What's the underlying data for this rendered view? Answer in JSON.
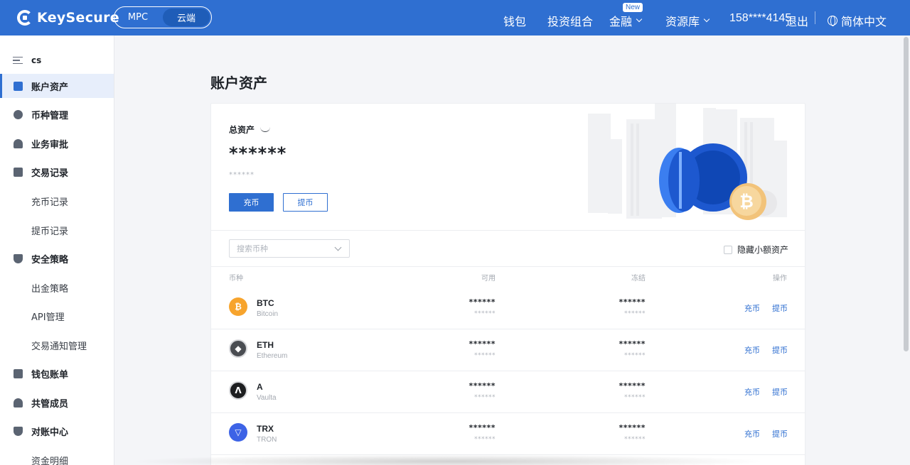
{
  "header": {
    "logo_text": "KeySecure",
    "mode_tabs": [
      "MPC",
      "云端"
    ],
    "nav": {
      "wallet": "钱包",
      "portfolio": "投资组合",
      "finance": "金融",
      "finance_badge": "New",
      "resources": "资源库",
      "phone": "158****4145",
      "logout": "退出",
      "language": "简体中文"
    }
  },
  "sidebar": {
    "org_name": "cs",
    "items": [
      {
        "label": "账户资产",
        "icon": "wallet-icon",
        "active": true
      },
      {
        "label": "币种管理",
        "icon": "coin-icon"
      },
      {
        "label": "业务审批",
        "icon": "approval-icon"
      },
      {
        "label": "交易记录",
        "icon": "document-icon"
      },
      {
        "label": "充币记录",
        "sub": true
      },
      {
        "label": "提币记录",
        "sub": true
      },
      {
        "label": "安全策略",
        "icon": "shield-icon"
      },
      {
        "label": "出金策略",
        "sub": true
      },
      {
        "label": "API管理",
        "sub": true
      },
      {
        "label": "交易通知管理",
        "sub": true
      },
      {
        "label": "钱包账单",
        "icon": "bill-icon"
      },
      {
        "label": "共管成员",
        "icon": "members-icon"
      },
      {
        "label": "对账中心",
        "icon": "shield-icon"
      },
      {
        "label": "资金明细",
        "sub": true
      }
    ]
  },
  "main": {
    "page_title": "账户资产",
    "total_label": "总资产",
    "total_value": "******",
    "total_sub": "******",
    "deposit_btn": "充币",
    "withdraw_btn": "提币",
    "search_placeholder": "搜索币种",
    "hide_small_label": "隐藏小额资产",
    "columns": {
      "coin": "币种",
      "available": "可用",
      "frozen": "冻结",
      "actions": "操作"
    },
    "rows": [
      {
        "symbol": "BTC",
        "name": "Bitcoin",
        "available": "******",
        "available_sub": "******",
        "frozen": "******",
        "frozen_sub": "******",
        "deposit": "充币",
        "withdraw": "提币",
        "color": "#f7a42d"
      },
      {
        "symbol": "ETH",
        "name": "Ethereum",
        "available": "******",
        "available_sub": "******",
        "frozen": "******",
        "frozen_sub": "******",
        "deposit": "充币",
        "withdraw": "提币",
        "color": "#4a4d52"
      },
      {
        "symbol": "A",
        "name": "Vaulta",
        "available": "******",
        "available_sub": "******",
        "frozen": "******",
        "frozen_sub": "******",
        "deposit": "充币",
        "withdraw": "提币",
        "color": "#1d1e20"
      },
      {
        "symbol": "TRX",
        "name": "TRON",
        "available": "******",
        "available_sub": "******",
        "frozen": "******",
        "frozen_sub": "******",
        "deposit": "充币",
        "withdraw": "提币",
        "color": "#3d63e6"
      }
    ]
  },
  "colors": {
    "brand": "#2f6fd1",
    "active_bg": "#e7eefb"
  }
}
